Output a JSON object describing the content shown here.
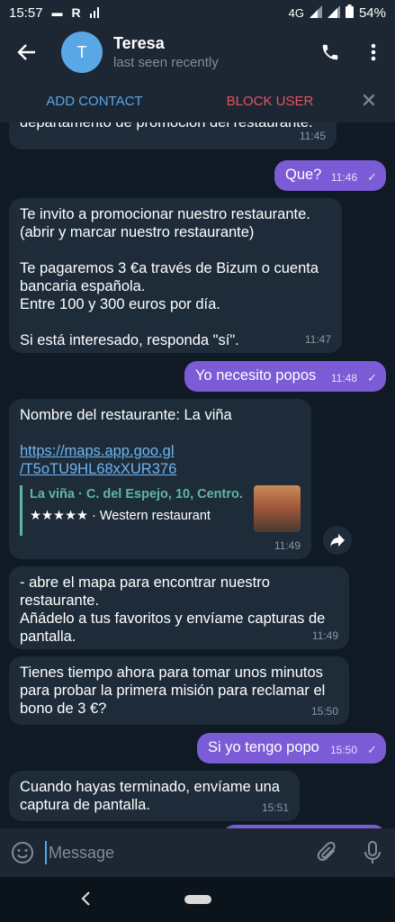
{
  "status_bar": {
    "time": "15:57",
    "network": "4G",
    "battery": "54%"
  },
  "header": {
    "avatar_letter": "T",
    "name": "Teresa",
    "status": "last seen recently"
  },
  "action_bar": {
    "add_contact": "ADD CONTACT",
    "block_user": "BLOCK USER"
  },
  "messages": [
    {
      "text": "departamento de promoción del restaurante.",
      "time": "11:45"
    },
    {
      "text": "Que?",
      "time": "11:46"
    },
    {
      "text": "Te invito a promocionar nuestro restaurante.\n(abrir y marcar nuestro restaurante)\n\nTe pagaremos 3 €a través de Bizum o cuenta\nbancaria española.\nEntre 100 y 300 euros por día.\n\nSi está interesado, responda \"sí\".",
      "time": "11:47"
    },
    {
      "text": "Yo necesito popos",
      "time": "11:48"
    },
    {
      "text": "Nombre del restaurante: La viña",
      "link_line1": "https://maps.app.goo.gl",
      "link_line2": "/T5oTU9HL68xXUR376",
      "preview_title": "La viña · C. del Espejo, 10, Centro...",
      "preview_sub": "★★★★★ · Western restaurant",
      "time": "11:49"
    },
    {
      "text": "- abre el mapa para encontrar nuestro\nrestaurante.\nAñádelo a tus favoritos y envíame capturas de\npantalla.",
      "time": "11:49"
    },
    {
      "text": "Tienes tiempo ahora para tomar unos minutos\npara probar la primera misión para reclamar el\nbono de 3 €?",
      "time": "15:50"
    },
    {
      "text": "Si yo tengo popo",
      "time": "15:50"
    },
    {
      "text": "Cuando hayas terminado, envíame una\ncaptura de pantalla.",
      "time": "15:51"
    }
  ],
  "composer": {
    "placeholder": "Message"
  },
  "colors": {
    "accent": "#5aa7e6",
    "outgoing": "#7b5bd6",
    "incoming": "#1e2c3a",
    "danger": "#e5545e"
  }
}
